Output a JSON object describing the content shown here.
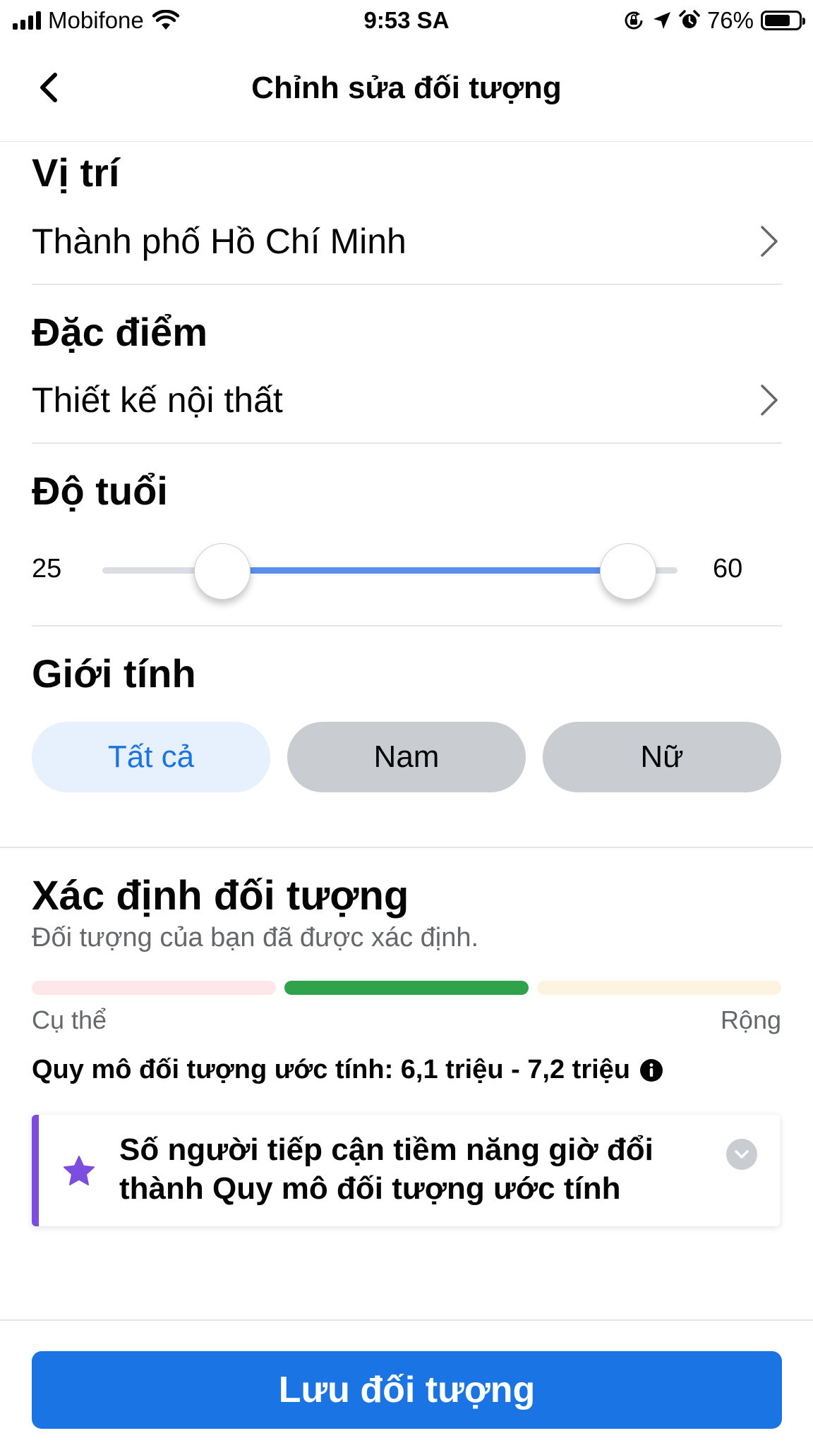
{
  "status_bar": {
    "carrier": "Mobifone",
    "time": "9:53 SA",
    "battery": "76%",
    "battery_level": 0.76
  },
  "header": {
    "title": "Chỉnh sửa đối tượng",
    "back_icon": "chevron-left-icon"
  },
  "location": {
    "title": "Vị trí",
    "value": "Thành phố Hồ Chí Minh"
  },
  "traits": {
    "title": "Đặc điểm",
    "value": "Thiết kế nội thất"
  },
  "age": {
    "title": "Độ tuổi",
    "min_label": "25",
    "max_label": "60",
    "min": 25,
    "max": 60
  },
  "gender": {
    "title": "Giới tính",
    "options": [
      "Tất cả",
      "Nam",
      "Nữ"
    ],
    "selected": "Tất cả"
  },
  "definition": {
    "title": "Xác định đối tượng",
    "subtitle": "Đối tượng của bạn đã được xác định.",
    "scale_left": "Cụ thể",
    "scale_right": "Rộng",
    "active_segment": 2,
    "estimate": "Quy mô đối tượng ước tính: 6,1 triệu - 7,2 triệu"
  },
  "notice": {
    "text": "Số người tiếp cận tiềm năng giờ đổi thành Quy mô đối tượng ước tính"
  },
  "save_label": "Lưu đối tượng",
  "colors": {
    "accent": "#1b74e4",
    "selected_pill_bg": "#e7f0fd",
    "slider_fill": "#5b8fee",
    "segment_active": "#31a24c",
    "notice_bar": "#7b4ee0"
  }
}
